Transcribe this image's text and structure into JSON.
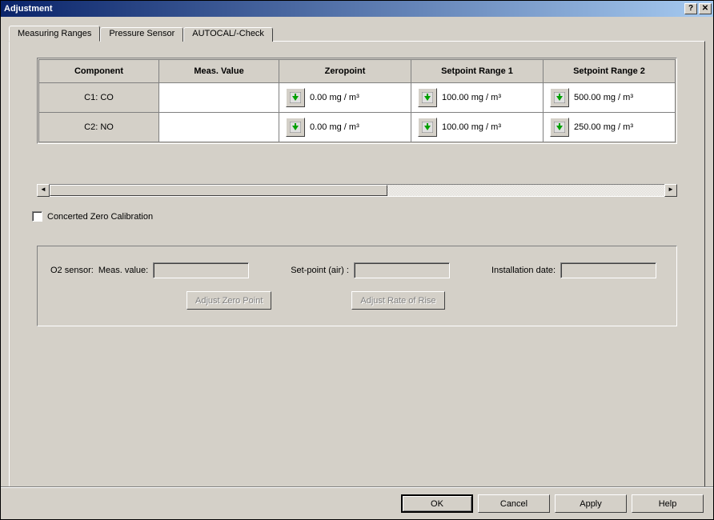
{
  "window": {
    "title": "Adjustment"
  },
  "tabs": {
    "t0": "Measuring Ranges",
    "t1": "Pressure Sensor",
    "t2": "AUTOCAL/-Check"
  },
  "table": {
    "headers": {
      "component": "Component",
      "meas_value": "Meas. Value",
      "zeropoint": "Zeropoint",
      "setpoint1": "Setpoint Range 1",
      "setpoint2": "Setpoint Range 2"
    },
    "rows": [
      {
        "component": "C1: CO",
        "meas_value": "",
        "zeropoint": "0.00 mg / m³",
        "setpoint1": "100.00 mg / m³",
        "setpoint2": "500.00 mg / m³"
      },
      {
        "component": "C2: NO",
        "meas_value": "",
        "zeropoint": "0.00 mg / m³",
        "setpoint1": "100.00 mg / m³",
        "setpoint2": "250.00 mg / m³"
      }
    ]
  },
  "checkbox": {
    "concerted_zero": "Concerted Zero Calibration"
  },
  "o2": {
    "sensor_label": "O2 sensor:",
    "meas_value_label": "Meas. value:",
    "setpoint_label": "Set-point (air) :",
    "install_label": "Installation date:",
    "adjust_zero_btn": "Adjust Zero Point",
    "adjust_rate_btn": "Adjust Rate of Rise"
  },
  "footer": {
    "ok": "OK",
    "cancel": "Cancel",
    "apply": "Apply",
    "help": "Help"
  }
}
